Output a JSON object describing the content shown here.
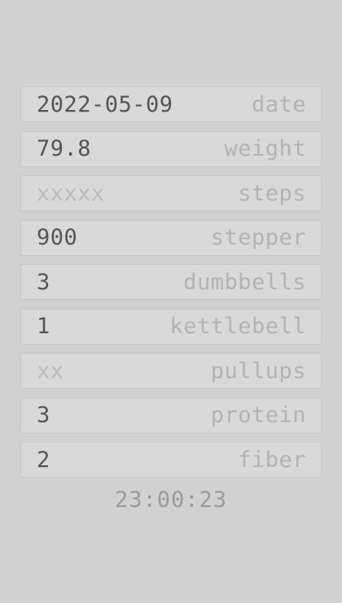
{
  "fields": [
    {
      "value": "2022-05-09",
      "filled": true,
      "label": "date"
    },
    {
      "value": "79.8",
      "filled": true,
      "label": "weight"
    },
    {
      "value": "xxxxx",
      "filled": false,
      "label": "steps"
    },
    {
      "value": "900",
      "filled": true,
      "label": "stepper"
    },
    {
      "value": "3",
      "filled": true,
      "label": "dumbbells"
    },
    {
      "value": "1",
      "filled": true,
      "label": "kettlebell"
    },
    {
      "value": "xx",
      "filled": false,
      "label": "pullups"
    },
    {
      "value": "3",
      "filled": true,
      "label": "protein"
    },
    {
      "value": "2",
      "filled": true,
      "label": "fiber"
    }
  ],
  "clock": "23:00:23"
}
